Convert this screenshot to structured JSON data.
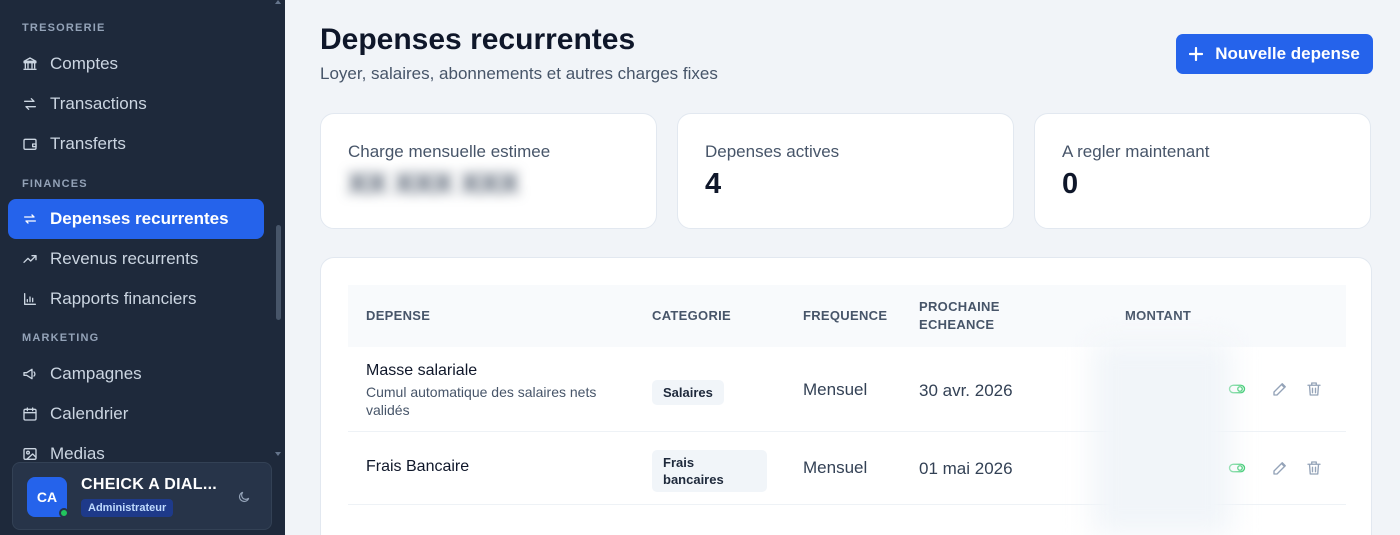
{
  "sidebar": {
    "sections": [
      {
        "label": "TRESORERIE",
        "items": [
          {
            "label": "Comptes",
            "icon": "bank-icon"
          },
          {
            "label": "Transactions",
            "icon": "arrows-exchange-icon"
          },
          {
            "label": "Transferts",
            "icon": "wallet-icon"
          }
        ]
      },
      {
        "label": "FINANCES",
        "items": [
          {
            "label": "Depenses recurrentes",
            "icon": "repeat-icon",
            "active": true
          },
          {
            "label": "Revenus recurrents",
            "icon": "trending-up-icon"
          },
          {
            "label": "Rapports financiers",
            "icon": "bar-chart-icon"
          }
        ]
      },
      {
        "label": "MARKETING",
        "items": [
          {
            "label": "Campagnes",
            "icon": "megaphone-icon"
          },
          {
            "label": "Calendrier",
            "icon": "calendar-icon"
          },
          {
            "label": "Medias",
            "icon": "image-icon"
          }
        ]
      }
    ],
    "user": {
      "initials": "CA",
      "name": "CHEICK A DIAL...",
      "role": "Administrateur",
      "status": "online"
    }
  },
  "header": {
    "title": "Depenses recurrentes",
    "subtitle": "Loyer, salaires, abonnements et autres charges fixes",
    "new_button_label": "Nouvelle depense"
  },
  "stats": [
    {
      "label": "Charge mensuelle estimee",
      "value": "XX XXX XXX",
      "blurred": true
    },
    {
      "label": "Depenses actives",
      "value": "4"
    },
    {
      "label": "A regler maintenant",
      "value": "0"
    }
  ],
  "table": {
    "columns": [
      "DEPENSE",
      "CATEGORIE",
      "FREQUENCE",
      "PROCHAINE ECHEANCE",
      "MONTANT"
    ],
    "columns_split": {
      "next_due_line1": "PROCHAINE",
      "next_due_line2": "ECHEANCE"
    },
    "rows": [
      {
        "name": "Masse salariale",
        "description": "Cumul automatique des salaires nets validés",
        "category": "Salaires",
        "frequency": "Mensuel",
        "next_due": "30 avr. 2026",
        "active": true
      },
      {
        "name": "Frais Bancaire",
        "description": "",
        "category": "Frais bancaires",
        "frequency": "Mensuel",
        "next_due": "01 mai 2026",
        "active": true
      }
    ]
  },
  "colors": {
    "sidebar_bg": "#1e293b",
    "accent": "#2563eb",
    "active_toggle": "#22c55e"
  }
}
